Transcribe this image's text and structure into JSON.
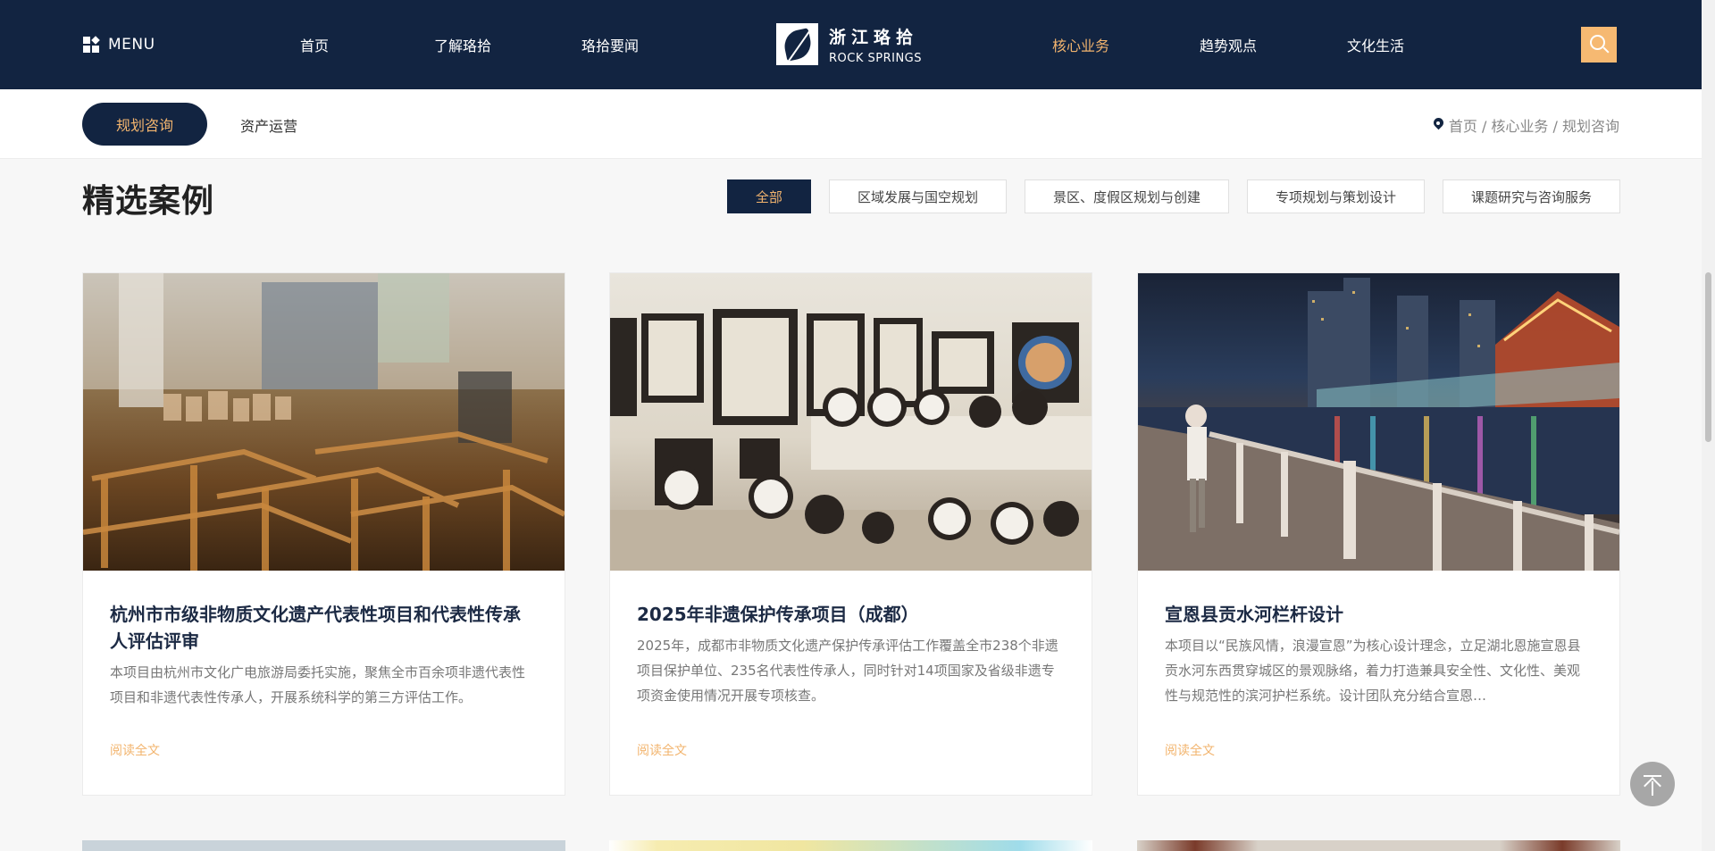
{
  "header": {
    "menu_label": "MENU",
    "nav_left": [
      "首页",
      "了解珞拾",
      "珞拾要闻"
    ],
    "logo_cn": "浙江珞拾",
    "logo_en": "ROCK SPRINGS",
    "nav_right": [
      "核心业务",
      "趋势观点",
      "文化生活"
    ],
    "active_nav": "核心业务"
  },
  "subnav": {
    "tabs": [
      "规划咨询",
      "资产运营"
    ],
    "active": "规划咨询",
    "breadcrumb": "首页 / 核心业务 / 规划咨询"
  },
  "section": {
    "title": "精选案例",
    "filters": [
      "全部",
      "区域发展与国空规划",
      "景区、度假区规划与创建",
      "专项规划与策划设计",
      "课题研究与咨询服务"
    ],
    "active_filter": "全部"
  },
  "cards": [
    {
      "title": "杭州市市级非物质文化遗产代表性项目和代表性传承人评估评审",
      "desc": "本项目由杭州市文化广电旅游局委托实施，聚焦全市百余项非遗代表性项目和非遗代表性传承人，开展系统科学的第三方评估工作。",
      "more": "阅读全文"
    },
    {
      "title": "2025年非遗保护传承项目（成都）",
      "desc": "2025年，成都市非物质文化遗产保护传承评估工作覆盖全市238个非遗项目保护单位、235名代表性传承人，同时针对14项国家及省级非遗专项资金使用情况开展专项核查。",
      "more": "阅读全文"
    },
    {
      "title": "宣恩县贡水河栏杆设计",
      "desc": "本项目以“民族风情，浪漫宣恩”为核心设计理念，立足湖北恩施宣恩县贡水河东西贯穿城区的景观脉络，着力打造兼具安全性、文化性、美观性与规范性的滨河护栏系统。设计团队充分结合宣恩…",
      "more": "阅读全文"
    }
  ],
  "colors": {
    "navy": "#122441",
    "accent": "#f2b46e",
    "search_bg": "#f6b972"
  },
  "icons": [
    "menu-icon",
    "logo-icon",
    "search-icon",
    "location-pin-icon",
    "back-to-top-icon"
  ]
}
